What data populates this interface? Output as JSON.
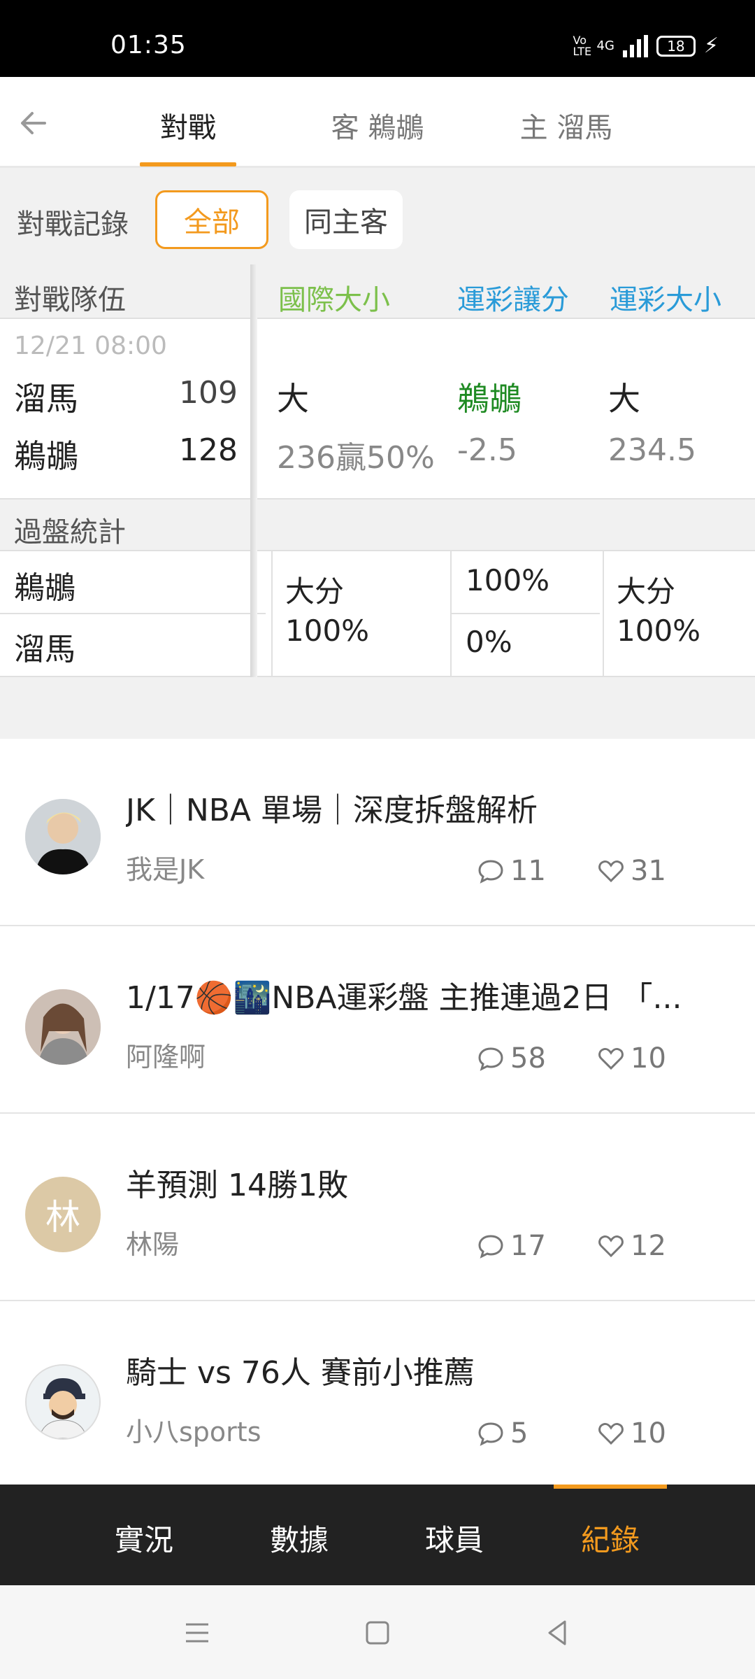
{
  "status_bar": {
    "time": "01:35",
    "network": "4G",
    "volte": "Vo LTE",
    "battery": "18"
  },
  "top_tabs": [
    {
      "label": "對戰",
      "active": true
    },
    {
      "label": "客 鵜鶘",
      "active": false
    },
    {
      "label": "主 溜馬",
      "active": false
    }
  ],
  "filter": {
    "label": "對戰記錄",
    "options": [
      "全部",
      "同主客"
    ],
    "selected": "全部"
  },
  "table": {
    "headers": {
      "team": "對戰隊伍",
      "intl_ou": "國際大小",
      "spread": "運彩讓分",
      "ou": "運彩大小"
    },
    "header_colors": {
      "intl_ou": "#7cc04b",
      "spread": "#2a9bd8",
      "ou": "#2a9bd8"
    },
    "match": {
      "date": "12/21 08:00",
      "away": {
        "team": "溜馬",
        "score": "109"
      },
      "home": {
        "team": "鵜鶘",
        "score": "128"
      },
      "intl_ou": {
        "result": "大",
        "line": "236贏50%"
      },
      "spread": {
        "result": "鵜鶘",
        "line": "-2.5",
        "color": "#1e8a22"
      },
      "ou": {
        "result": "大",
        "line": "234.5"
      }
    },
    "stats_label": "過盤統計",
    "stats": {
      "teams": [
        "鵜鶘",
        "溜馬"
      ],
      "intl_ou": {
        "label": "大分",
        "value": "100%"
      },
      "spread": [
        "100%",
        "0%"
      ],
      "ou": {
        "label": "大分",
        "value": "100%"
      }
    }
  },
  "articles": [
    {
      "title": "JK｜NBA 單場｜深度拆盤解析",
      "author": "我是JK",
      "comments": "11",
      "likes": "31",
      "avatar": "photo"
    },
    {
      "title": "1/17🏀🌃NBA運彩盤 主推連過2日 「...",
      "author": "阿隆啊",
      "comments": "58",
      "likes": "10",
      "avatar": "photo"
    },
    {
      "title": "羊預測 14勝1敗",
      "author": "林陽",
      "comments": "17",
      "likes": "12",
      "avatar": "林"
    },
    {
      "title": "騎士 vs 76人  賽前小推薦",
      "author": "小八sports",
      "comments": "5",
      "likes": "10",
      "avatar": "cartoon"
    }
  ],
  "bottom_nav": [
    {
      "label": "實況",
      "active": false
    },
    {
      "label": "數據",
      "active": false
    },
    {
      "label": "球員",
      "active": false
    },
    {
      "label": "紀錄",
      "active": true
    }
  ],
  "colors": {
    "accent": "#f39a1e",
    "bottom_nav_bg": "#222222"
  }
}
